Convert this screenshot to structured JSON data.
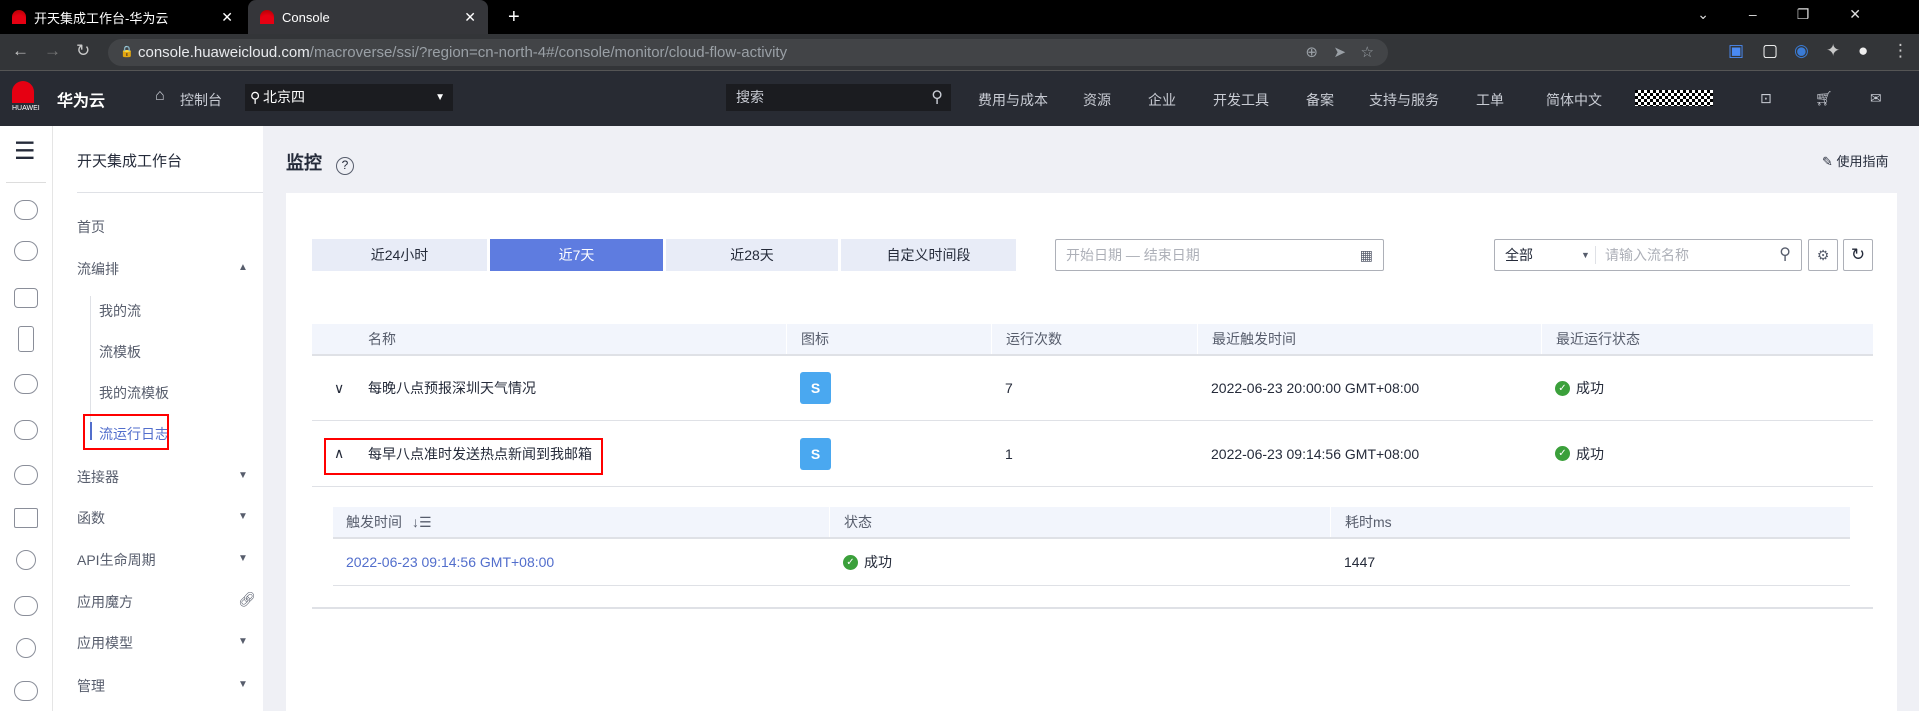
{
  "browser": {
    "tabs": [
      {
        "title": "开天集成工作台-华为云"
      },
      {
        "title": "Console"
      }
    ],
    "new_tab": "+",
    "url_host": "console.huaweicloud.com",
    "url_path": "/macroverse/ssi/?region=cn-north-4#/console/monitor/cloud-flow-activity"
  },
  "topnav": {
    "brand": "华为云",
    "logo_text": "HUAWEI",
    "console": "控制台",
    "region": "北京四",
    "search_placeholder": "搜索",
    "items": [
      "费用与成本",
      "资源",
      "企业",
      "开发工具",
      "备案",
      "支持与服务",
      "工单",
      "简体中文"
    ]
  },
  "sidebar": {
    "title": "开天集成工作台",
    "items": [
      {
        "label": "首页"
      },
      {
        "label": "流编排",
        "arrow": "▲"
      },
      {
        "label": "我的流"
      },
      {
        "label": "流模板"
      },
      {
        "label": "我的流模板"
      },
      {
        "label": "流运行日志",
        "active": true
      },
      {
        "label": "连接器",
        "arrow": "▼"
      },
      {
        "label": "函数",
        "arrow": "▼"
      },
      {
        "label": "API生命周期",
        "arrow": "▼"
      },
      {
        "label": "应用魔方",
        "icon": "link-icon"
      },
      {
        "label": "应用模型",
        "arrow": "▼"
      },
      {
        "label": "管理",
        "arrow": "▼"
      }
    ]
  },
  "page": {
    "title": "监控",
    "guide": "使用指南"
  },
  "filters": {
    "time_tabs": [
      "近24小时",
      "近7天",
      "近28天",
      "自定义时间段"
    ],
    "selected": "近7天",
    "date_placeholder": "开始日期 — 结束日期",
    "select_value": "全部",
    "search_placeholder": "请输入流名称"
  },
  "table": {
    "headers": [
      "名称",
      "图标",
      "运行次数",
      "最近触发时间",
      "最近运行状态"
    ],
    "rows": [
      {
        "name": "每晚八点预报深圳天气情况",
        "runs": "7",
        "last": "2022-06-23 20:00:00 GMT+08:00",
        "status": "成功",
        "expanded": false
      },
      {
        "name": "每早八点准时发送热点新闻到我邮箱",
        "runs": "1",
        "last": "2022-06-23 09:14:56 GMT+08:00",
        "status": "成功",
        "expanded": true
      }
    ]
  },
  "subtable": {
    "headers": [
      "触发时间",
      "状态",
      "耗时ms"
    ],
    "rows": [
      {
        "time": "2022-06-23 09:14:56 GMT+08:00",
        "status": "成功",
        "duration": "1447"
      }
    ]
  },
  "colors": {
    "accent": "#5e7ce0",
    "success": "#3ba03b",
    "highlight": "#ff0000",
    "nav_bg": "#282b33"
  }
}
